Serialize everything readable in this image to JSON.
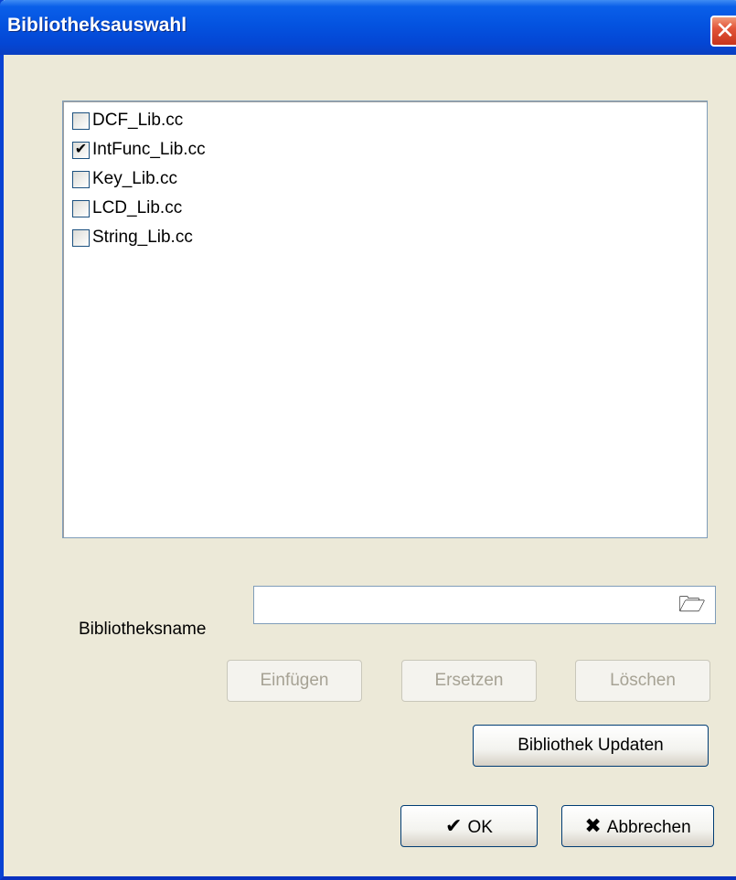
{
  "window": {
    "title": "Bibliotheksauswahl",
    "close_glyph": "✕"
  },
  "library_list": {
    "items": [
      {
        "label": "DCF_Lib.cc",
        "checked": false,
        "mark": ""
      },
      {
        "label": "IntFunc_Lib.cc",
        "checked": true,
        "mark": "✔"
      },
      {
        "label": "Key_Lib.cc",
        "checked": false,
        "mark": ""
      },
      {
        "label": "LCD_Lib.cc",
        "checked": false,
        "mark": ""
      },
      {
        "label": "String_Lib.cc",
        "checked": false,
        "mark": ""
      }
    ]
  },
  "library_name": {
    "label": "Bibliotheksname",
    "value": "",
    "browse_icon": "folder-open-icon",
    "browse_glyph": "🗁"
  },
  "actions": {
    "insert": "Einfügen",
    "replace": "Ersetzen",
    "delete": "Löschen",
    "update": "Bibliothek Updaten"
  },
  "dialog_buttons": {
    "ok": "OK",
    "ok_glyph": "✔",
    "cancel": "Abbrechen",
    "cancel_glyph": "✖"
  },
  "colors": {
    "titlebar": "#0453e0",
    "close": "#e2553a",
    "dialog_bg": "#ece9d8"
  }
}
